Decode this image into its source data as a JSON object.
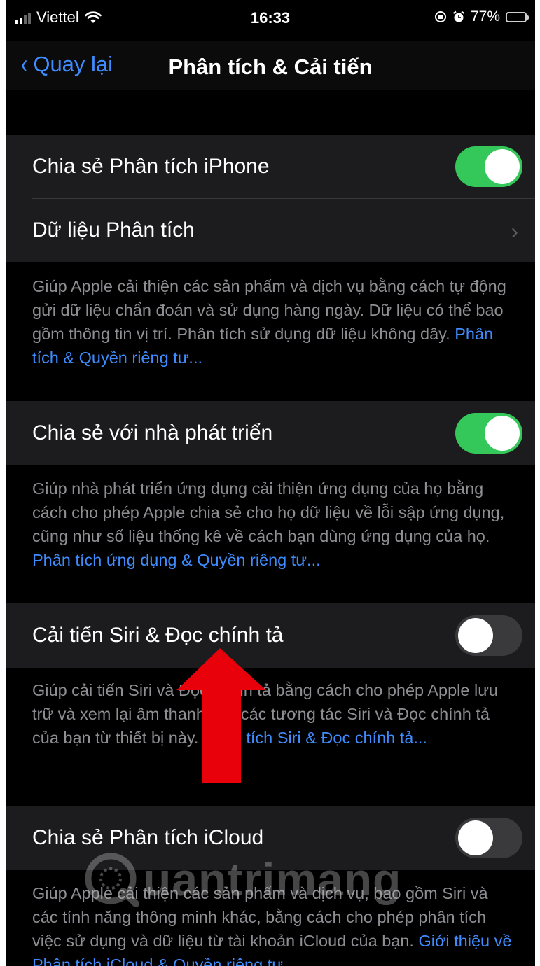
{
  "status_bar": {
    "carrier": "Viettel",
    "time": "16:33",
    "battery": "77%",
    "icons": [
      "signal-icon",
      "wifi-icon",
      "orientation-lock-icon",
      "alarm-icon",
      "battery-icon"
    ]
  },
  "nav": {
    "back_label": "Quay lại",
    "title": "Phân tích & Cải tiến"
  },
  "sections": [
    {
      "rows": [
        {
          "label": "Chia sẻ Phân tích iPhone",
          "toggle": "on"
        },
        {
          "label": "Dữ liệu Phân tích",
          "chevron": true
        }
      ],
      "footer": "Giúp Apple cải thiện các sản phẩm và dịch vụ bằng cách tự động gửi dữ liệu chẩn đoán và sử dụng hàng ngày. Dữ liệu có thể bao gồm thông tin vị trí. Phân tích sử dụng dữ liệu không dây. ",
      "footer_link": "Phân tích & Quyền riêng tư..."
    },
    {
      "rows": [
        {
          "label": "Chia sẻ với nhà phát triển",
          "toggle": "on"
        }
      ],
      "footer": "Giúp nhà phát triển ứng dụng cải thiện ứng dụng của họ bằng cách cho phép Apple chia sẻ cho họ dữ liệu về lỗi sập ứng dụng, cũng như số liệu thống kê về cách bạn dùng ứng dụng của họ. ",
      "footer_link": "Phân tích ứng dụng & Quyền riêng tư..."
    },
    {
      "rows": [
        {
          "label": "Cải tiến Siri & Đọc chính tả",
          "toggle": "off"
        }
      ],
      "footer": "Giúp cải tiến Siri và Đọc chính tả bằng cách cho phép Apple lưu trữ và xem lại âm thanh của các tương tác Siri và Đọc chính tả của bạn từ thiết bị này. ",
      "footer_link": "Phân tích Siri & Đọc chính tả..."
    },
    {
      "rows": [
        {
          "label": "Chia sẻ Phân tích iCloud",
          "toggle": "off"
        }
      ],
      "footer": "Giúp Apple cải thiện các sản phẩm và dịch vụ, bao gồm Siri và các tính năng thông minh khác, bằng cách cho phép phân tích việc sử dụng và dữ liệu từ tài khoản iCloud của bạn. ",
      "footer_link": "Giới thiệu về Phân tích iCloud & Quyền riêng tư..."
    }
  ],
  "watermark": "uantrimang",
  "colors": {
    "accent": "#3f8cff",
    "toggle_on": "#34c759",
    "annotation_arrow": "#e8000b"
  }
}
